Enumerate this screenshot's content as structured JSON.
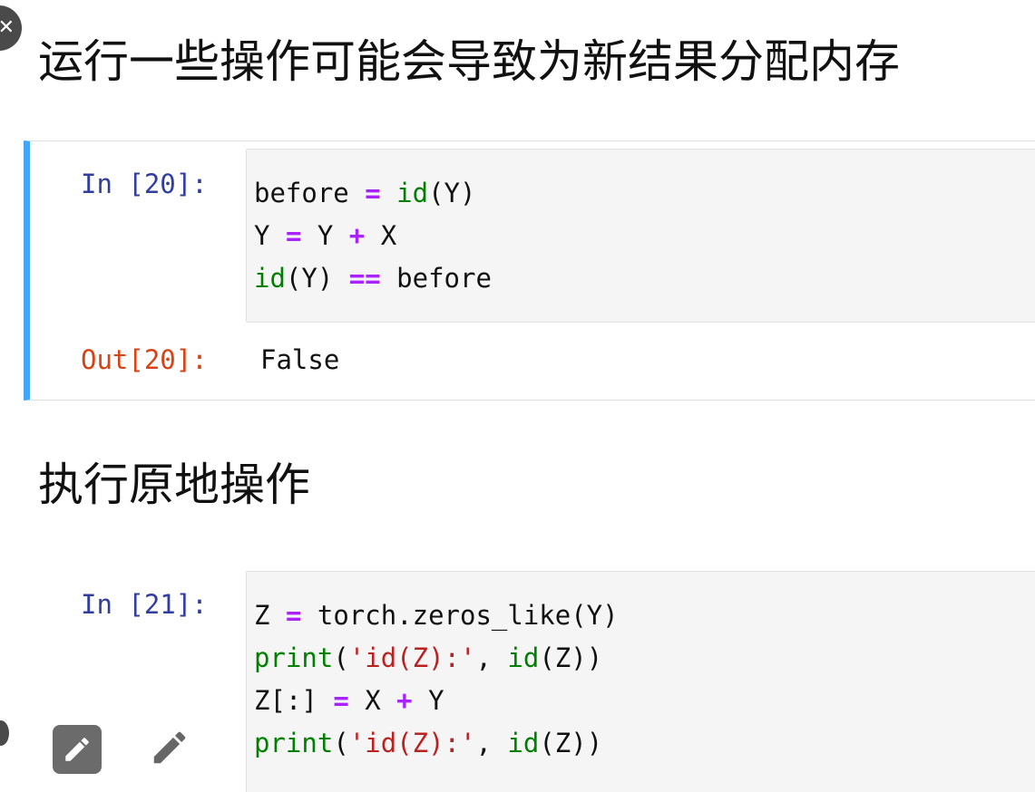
{
  "markdown": {
    "heading1": "运行一些操作可能会导致为新结果分配内存",
    "heading2": "执行原地操作"
  },
  "cells": [
    {
      "in_prompt": "In [20]:",
      "code_lines": [
        [
          [
            "before",
            "var"
          ],
          [
            " ",
            "punc"
          ],
          [
            "=",
            "op"
          ],
          [
            " ",
            "punc"
          ],
          [
            "id",
            "builtin"
          ],
          [
            "(Y)",
            "punc"
          ]
        ],
        [
          [
            "Y",
            "var"
          ],
          [
            " ",
            "punc"
          ],
          [
            "=",
            "op"
          ],
          [
            " Y ",
            "punc"
          ],
          [
            "+",
            "op"
          ],
          [
            " X",
            "punc"
          ]
        ],
        [
          [
            "id",
            "builtin"
          ],
          [
            "(Y) ",
            "punc"
          ],
          [
            "==",
            "op"
          ],
          [
            " before",
            "var"
          ]
        ]
      ],
      "out_prompt": "Out[20]:",
      "output": "False"
    },
    {
      "in_prompt": "In [21]:",
      "code_lines": [
        [
          [
            "Z",
            "var"
          ],
          [
            " ",
            "punc"
          ],
          [
            "=",
            "op"
          ],
          [
            " torch.zeros_like(Y)",
            "punc"
          ]
        ],
        [
          [
            "print",
            "builtin"
          ],
          [
            "(",
            "punc"
          ],
          [
            "'id(Z):'",
            "str"
          ],
          [
            ", ",
            "punc"
          ],
          [
            "id",
            "builtin"
          ],
          [
            "(Z))",
            "punc"
          ]
        ],
        [
          [
            "Z[:]",
            "var"
          ],
          [
            " ",
            "punc"
          ],
          [
            "=",
            "op"
          ],
          [
            " X ",
            "punc"
          ],
          [
            "+",
            "op"
          ],
          [
            " Y",
            "punc"
          ]
        ],
        [
          [
            "print",
            "builtin"
          ],
          [
            "(",
            "punc"
          ],
          [
            "'id(Z):'",
            "str"
          ],
          [
            ", ",
            "punc"
          ],
          [
            "id",
            "builtin"
          ],
          [
            "(Z))",
            "punc"
          ]
        ]
      ]
    }
  ],
  "toolbar": {
    "icons": [
      "edit-pencil-filled-icon",
      "edit-pencil-icon"
    ]
  },
  "colors": {
    "selected_cell_border": "#42a5f5",
    "in_prompt": "#303f9f",
    "out_prompt": "#d84315",
    "operator": "#aa22ff",
    "builtin": "#008000",
    "string": "#ba2121"
  }
}
